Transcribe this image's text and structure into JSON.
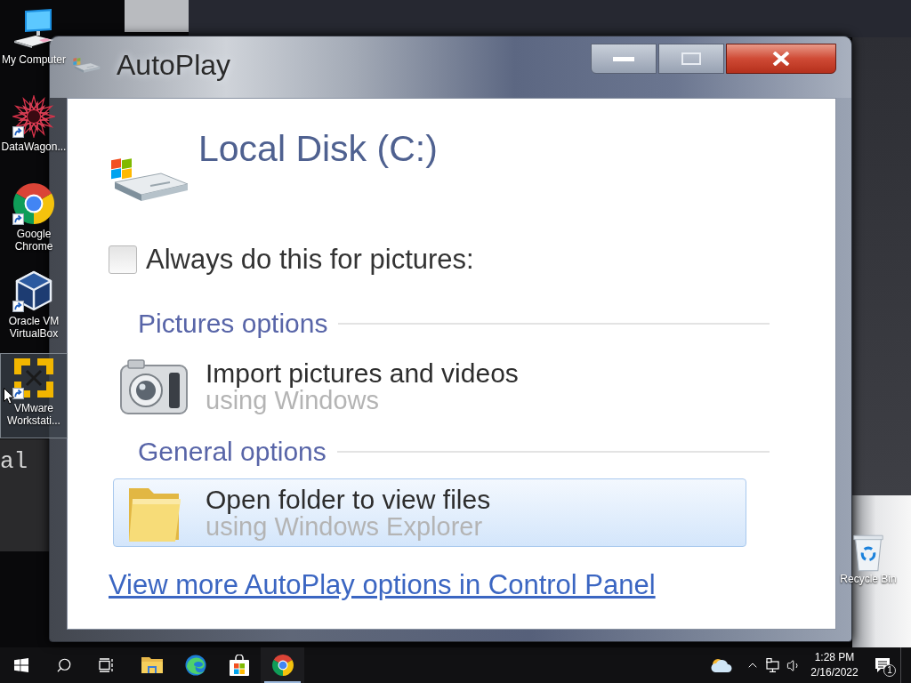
{
  "desktop": {
    "wallpaper_text": "al",
    "icons": [
      {
        "kind": "computer",
        "label": "My Computer",
        "shortcut": false,
        "selected": false
      },
      {
        "kind": "datawagon",
        "label": "DataWagon...",
        "shortcut": true,
        "selected": false
      },
      {
        "kind": "chrome",
        "label": "Google Chrome",
        "shortcut": true,
        "selected": false
      },
      {
        "kind": "virtualbox",
        "label": "Oracle VM VirtualBox",
        "shortcut": true,
        "selected": false
      },
      {
        "kind": "vmware",
        "label": "VMware Workstati...",
        "shortcut": true,
        "selected": true
      }
    ],
    "recycle_bin": {
      "label": "Recycle Bin"
    }
  },
  "dialog": {
    "title": "AutoPlay",
    "device_name": "Local Disk (C:)",
    "always_do": {
      "label": "Always do this for pictures:",
      "checked": false
    },
    "sections": [
      {
        "heading": "Pictures options",
        "options": [
          {
            "kind": "camera",
            "title": "Import pictures and videos",
            "subtitle": "using Windows",
            "selected": false
          }
        ]
      },
      {
        "heading": "General options",
        "options": [
          {
            "kind": "folder",
            "title": "Open folder to view files",
            "subtitle": "using Windows Explorer",
            "selected": true
          }
        ]
      }
    ],
    "link": "View more AutoPlay options in Control Panel"
  },
  "taskbar": {
    "system_buttons": [
      {
        "kind": "start"
      },
      {
        "kind": "search"
      },
      {
        "kind": "taskview"
      }
    ],
    "pinned_apps": [
      {
        "kind": "explorer",
        "running": false
      },
      {
        "kind": "edge",
        "running": false
      },
      {
        "kind": "store",
        "running": false
      },
      {
        "kind": "chrome",
        "running": true
      }
    ],
    "tray": [
      {
        "kind": "weather"
      },
      {
        "kind": "chevron"
      },
      {
        "kind": "network"
      },
      {
        "kind": "volume"
      }
    ],
    "clock": {
      "time": "1:28 PM",
      "date": "2/16/2022"
    },
    "notifications": {
      "count": "1"
    }
  }
}
